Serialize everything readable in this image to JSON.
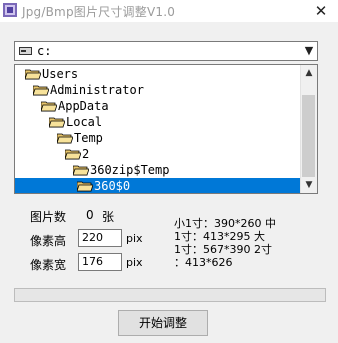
{
  "window": {
    "title": "Jpg/Bmp图片尺寸调整V1.0",
    "close_glyph": "✕"
  },
  "drive": {
    "value": "c:",
    "icon": "drive-icon"
  },
  "tree": {
    "items": [
      {
        "label": "Users"
      },
      {
        "label": "Administrator"
      },
      {
        "label": "AppData"
      },
      {
        "label": "Local"
      },
      {
        "label": "Temp"
      },
      {
        "label": "2"
      },
      {
        "label": "360zip$Temp"
      },
      {
        "label": "360$0",
        "selected": true
      }
    ]
  },
  "form": {
    "count_label": "图片数",
    "count_value": "0",
    "count_unit": "张",
    "height_label": "像素高",
    "height_value": "220",
    "width_label": "像素宽",
    "width_value": "176",
    "pix_unit": "pix"
  },
  "info": {
    "lines": [
      "小1寸：390*260 中",
      "1寸：413*295 大",
      "1寸：567*390 2寸",
      "：413*626"
    ]
  },
  "progress": {
    "value": 0
  },
  "buttons": {
    "start": "开始调整"
  },
  "colors": {
    "selection": "#0078d7",
    "folder": "#e8c56a"
  }
}
